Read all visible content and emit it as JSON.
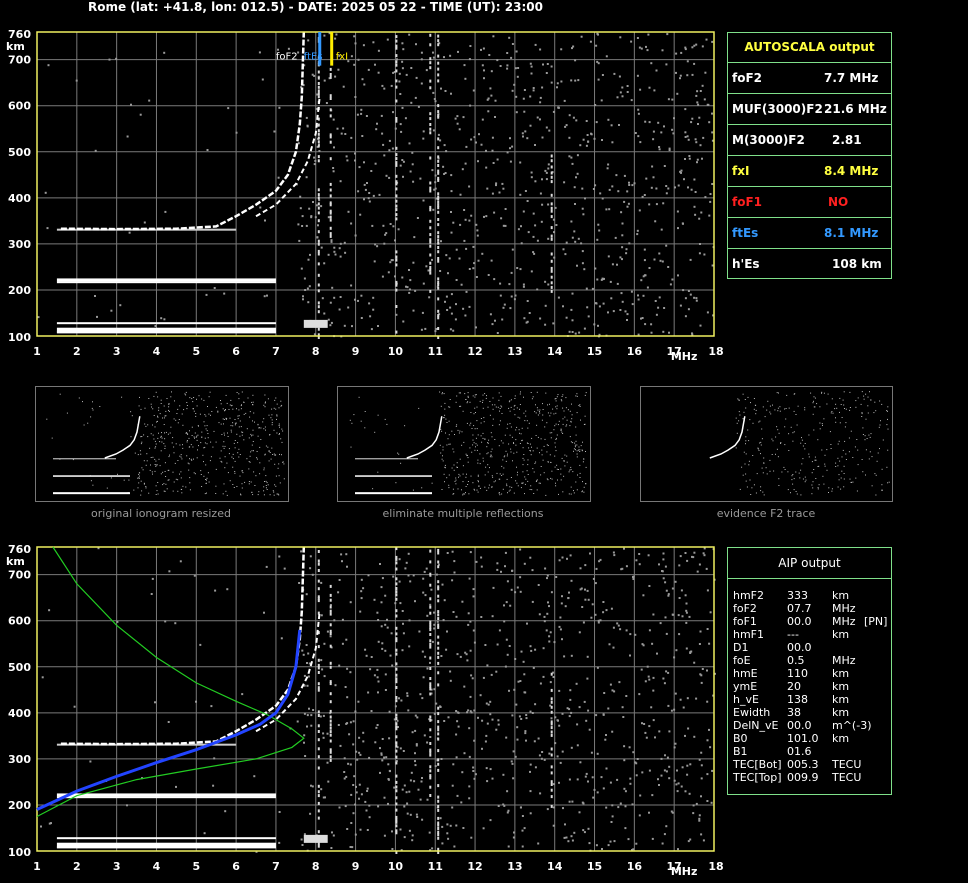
{
  "header": "Rome (lat: +41.8, lon: 012.5) - DATE: 2025 05 22 - TIME (UT): 23:00",
  "colors": {
    "axis": "#f0f060",
    "grid": "#7a7a7a",
    "trace": "#ffffff",
    "noise": "#9a9a9a",
    "profile": "#22cc22",
    "fit": "#2244ff",
    "foF2_marker": "#3399ff",
    "fxI_marker": "#ffee00",
    "panel_border": "#7fe08a",
    "red": "#ff2020",
    "blue": "#3399ff",
    "yellow": "#ffff40"
  },
  "chart_data": [
    {
      "type": "scatter",
      "name_id": "upper-ionogram",
      "xlabel": "MHz",
      "ylabel": "km",
      "xlim": [
        1,
        18
      ],
      "ylim": [
        100,
        760
      ],
      "x_ticks": [
        "1",
        "2",
        "3",
        "4",
        "5",
        "6",
        "7",
        "8",
        "9",
        "10",
        "11",
        "12",
        "13",
        "14",
        "15",
        "16",
        "17",
        "18"
      ],
      "y_ticks": [
        "100",
        "200",
        "300",
        "400",
        "500",
        "600",
        "700",
        "760"
      ],
      "grid": true,
      "markers": [
        {
          "label": "foF2",
          "freq": 7.7,
          "color": "#ffffff"
        },
        {
          "label": "ftEs",
          "freq": 8.1,
          "color": "#3399ff"
        },
        {
          "label": "fxI",
          "freq": 8.4,
          "color": "#ffee00"
        }
      ],
      "traces": {
        "E_layer": {
          "f_start": 1.5,
          "f_end": 7.0,
          "height": 118
        },
        "Es_multiple": {
          "f_start": 1.5,
          "f_end": 7.0,
          "height": 225
        },
        "F2_o": [
          [
            1.6,
            333
          ],
          [
            3.0,
            332
          ],
          [
            4.5,
            333
          ],
          [
            5.5,
            338
          ],
          [
            6.0,
            360
          ],
          [
            6.5,
            385
          ],
          [
            7.0,
            415
          ],
          [
            7.3,
            450
          ],
          [
            7.5,
            500
          ],
          [
            7.6,
            560
          ],
          [
            7.65,
            620
          ],
          [
            7.7,
            760
          ]
        ],
        "F2_x": [
          [
            6.5,
            360
          ],
          [
            7.0,
            385
          ],
          [
            7.5,
            430
          ],
          [
            7.8,
            480
          ],
          [
            8.0,
            540
          ],
          [
            8.1,
            620
          ]
        ]
      }
    },
    {
      "type": "scatter",
      "name_id": "lower-ionogram",
      "xlabel": "MHz",
      "ylabel": "km",
      "xlim": [
        1,
        18
      ],
      "ylim": [
        100,
        760
      ],
      "x_ticks": [
        "1",
        "2",
        "3",
        "4",
        "5",
        "6",
        "7",
        "8",
        "9",
        "10",
        "11",
        "12",
        "13",
        "14",
        "15",
        "16",
        "17",
        "18"
      ],
      "y_ticks": [
        "100",
        "200",
        "300",
        "400",
        "500",
        "600",
        "700",
        "760"
      ],
      "grid": true,
      "profile_curve": [
        [
          1.4,
          760
        ],
        [
          2.0,
          680
        ],
        [
          3.0,
          590
        ],
        [
          4.0,
          520
        ],
        [
          5.0,
          465
        ],
        [
          6.0,
          425
        ],
        [
          6.8,
          395
        ],
        [
          7.4,
          365
        ],
        [
          7.7,
          345
        ],
        [
          7.4,
          325
        ],
        [
          6.5,
          300
        ],
        [
          5.0,
          278
        ],
        [
          3.5,
          255
        ],
        [
          2.0,
          220
        ],
        [
          1.0,
          175
        ]
      ],
      "fitted_trace": [
        [
          1.0,
          190
        ],
        [
          2.0,
          230
        ],
        [
          3.0,
          262
        ],
        [
          4.0,
          292
        ],
        [
          5.0,
          320
        ],
        [
          6.0,
          352
        ],
        [
          6.6,
          375
        ],
        [
          7.0,
          400
        ],
        [
          7.3,
          440
        ],
        [
          7.5,
          500
        ],
        [
          7.6,
          580
        ]
      ]
    }
  ],
  "autoscala": {
    "title": "AUTOSCALA output",
    "rows": [
      {
        "label": "foF2",
        "value": "7.7 MHz",
        "color": "#ffffff"
      },
      {
        "label": "MUF(3000)F2",
        "value": "21.6 MHz",
        "color": "#ffffff"
      },
      {
        "label": "M(3000)F2",
        "value": "2.81",
        "color": "#ffffff"
      },
      {
        "label": "fxI",
        "value": "8.4 MHz",
        "color": "#ffff40"
      },
      {
        "label": "foF1",
        "value": "NO",
        "color": "#ff2020"
      },
      {
        "label": "ftEs",
        "value": "8.1 MHz",
        "color": "#3399ff"
      },
      {
        "label": "h'Es",
        "value": "108    km",
        "color": "#ffffff"
      }
    ]
  },
  "thumbnails": [
    {
      "caption": "original ionogram resized"
    },
    {
      "caption": "eliminate multiple reflections"
    },
    {
      "caption": "evidence F2 trace"
    }
  ],
  "aip": {
    "title": "AIP output",
    "rows": [
      {
        "param": "hmF2",
        "value": "333",
        "unit": "km",
        "extra": ""
      },
      {
        "param": "foF2",
        "value": "07.7",
        "unit": "MHz",
        "extra": ""
      },
      {
        "param": "foF1",
        "value": "00.0",
        "unit": "MHz",
        "extra": "[PN]"
      },
      {
        "param": "hmF1",
        "value": "---",
        "unit": "km",
        "extra": ""
      },
      {
        "param": "D1",
        "value": "00.0",
        "unit": "",
        "extra": ""
      },
      {
        "param": "foE",
        "value": "0.5",
        "unit": "MHz",
        "extra": ""
      },
      {
        "param": "hmE",
        "value": "110",
        "unit": "km",
        "extra": ""
      },
      {
        "param": "ymE",
        "value": "20",
        "unit": "km",
        "extra": ""
      },
      {
        "param": "h_vE",
        "value": "138",
        "unit": "km",
        "extra": ""
      },
      {
        "param": "Ewidth",
        "value": "38",
        "unit": "km",
        "extra": ""
      },
      {
        "param": "DelN_vE",
        "value": "00.0",
        "unit": "m^(-3)",
        "extra": ""
      },
      {
        "param": "B0",
        "value": "101.0",
        "unit": "km",
        "extra": ""
      },
      {
        "param": "B1",
        "value": "01.6",
        "unit": "",
        "extra": ""
      },
      {
        "param": "TEC[Bot]",
        "value": "005.3",
        "unit": "TECU",
        "extra": ""
      },
      {
        "param": "TEC[Top]",
        "value": "009.9",
        "unit": "TECU",
        "extra": ""
      }
    ]
  }
}
